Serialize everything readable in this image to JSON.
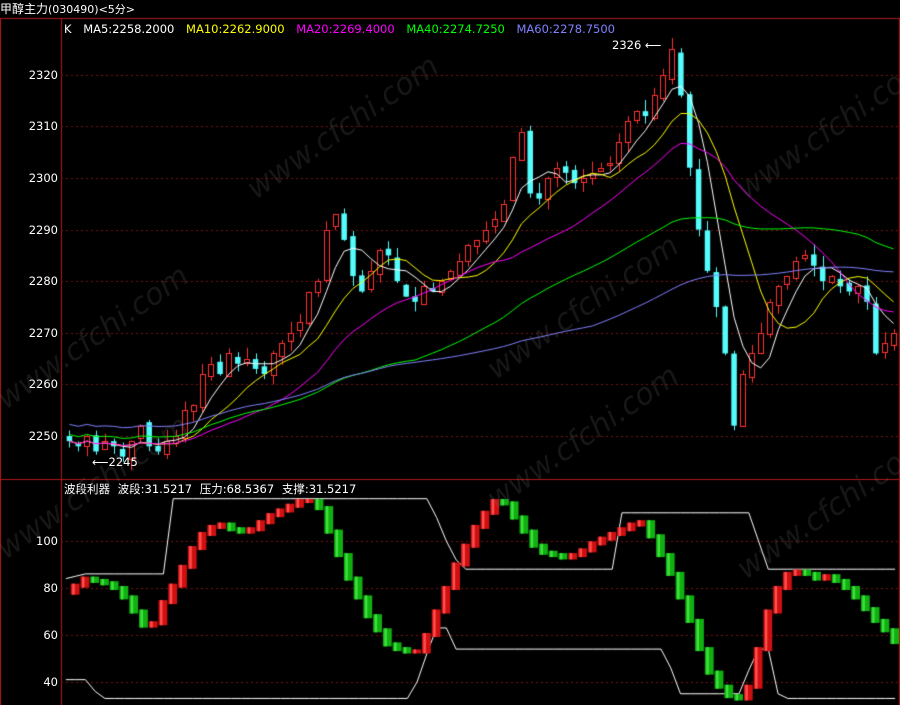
{
  "header": {
    "symbol_name": "甲醇主力",
    "symbol_code": "(030490)",
    "period": "<5分>"
  },
  "legend_main": {
    "k_label": "K",
    "ma5": "MA5:2258.2000",
    "ma10": "MA10:2262.9000",
    "ma20": "MA20:2269.4000",
    "ma40": "MA40:2274.7250",
    "ma60": "MA60:2278.7500"
  },
  "legend_indicator": {
    "name": "波段利器",
    "wave": "波段:31.5217",
    "pressure": "压力:68.5367",
    "support": "支撑:31.5217"
  },
  "annotations": {
    "high": "2326",
    "low": "2245"
  },
  "watermark": "www.cfchi.com",
  "colors": {
    "up": "#ff3232",
    "down": "#54fcfc",
    "ma5": "#ffffff",
    "ma10": "#ffff00",
    "ma20": "#ff00ff",
    "ma40": "#00ff00",
    "ma60": "#8080ff",
    "grid": "#7a1010",
    "frame": "#b01818"
  },
  "chart_data": [
    {
      "type": "candlestick",
      "y_ticks": [
        "2320",
        "2310",
        "2300",
        "2290",
        "2280",
        "2270",
        "2260",
        "2250"
      ],
      "ylim": [
        2244,
        2328
      ],
      "close": [
        2249,
        2248,
        2250,
        2247,
        2249,
        2248,
        2246,
        2249,
        2252,
        2248,
        2247,
        2249,
        2250,
        2255,
        2256,
        2262,
        2264,
        2262,
        2266,
        2264,
        2265,
        2263,
        2262,
        2266,
        2268,
        2270,
        2272,
        2278,
        2280,
        2290,
        2293,
        2288,
        2281,
        2278,
        2282,
        2286,
        2285,
        2280,
        2277,
        2276,
        2279,
        2278,
        2280,
        2282,
        2284,
        2287,
        2288,
        2290,
        2292,
        2295,
        2304,
        2309,
        2297,
        2296,
        2300,
        2302,
        2301,
        2299,
        2300,
        2301,
        2302,
        2303,
        2307,
        2311,
        2313,
        2312,
        2316,
        2320,
        2325,
        2316,
        2302,
        2290,
        2282,
        2275,
        2266,
        2252,
        2262,
        2266,
        2270,
        2276,
        2279,
        2281,
        2284,
        2285,
        2283,
        2280,
        2281,
        2279,
        2278,
        2279,
        2276,
        2266,
        2268,
        2270
      ]
    },
    {
      "type": "line",
      "title": "波段利器",
      "y_ticks": [
        "100",
        "80",
        "60",
        "40"
      ],
      "ylim": [
        30,
        123
      ],
      "series": [
        {
          "name": "波段",
          "values": [
            78,
            81,
            84,
            83,
            82,
            80,
            76,
            70,
            64,
            65,
            74,
            81,
            89,
            97,
            103,
            106,
            107,
            105,
            104,
            105,
            108,
            111,
            113,
            115,
            117,
            117,
            114,
            104,
            94,
            84,
            76,
            68,
            62,
            56,
            54,
            53,
            53,
            60,
            70,
            80,
            90,
            98,
            106,
            112,
            117,
            116,
            110,
            104,
            98,
            95,
            94,
            93,
            94,
            96,
            99,
            101,
            103,
            105,
            107,
            108,
            102,
            94,
            86,
            76,
            66,
            54,
            44,
            38,
            34,
            33,
            38,
            54,
            70,
            80,
            86,
            87,
            86,
            84,
            85,
            83,
            80,
            76,
            71,
            66,
            62,
            57
          ],
          "color_by_direction": true
        },
        {
          "name": "压力",
          "values": [
            84,
            85,
            86,
            86,
            86,
            86,
            86,
            86,
            86,
            86,
            86,
            118,
            118,
            118,
            118,
            118,
            118,
            118,
            118,
            118,
            118,
            118,
            118,
            118,
            118,
            118,
            118,
            118,
            118,
            118,
            118,
            118,
            118,
            118,
            118,
            118,
            118,
            118,
            110,
            100,
            92,
            88,
            88,
            88,
            88,
            88,
            88,
            88,
            88,
            88,
            88,
            88,
            88,
            88,
            88,
            88,
            88,
            112,
            112,
            112,
            112,
            112,
            112,
            112,
            112,
            112,
            112,
            112,
            112,
            112,
            112,
            100,
            88,
            88,
            88,
            88,
            88,
            88,
            88,
            88,
            88,
            88,
            88,
            88,
            88,
            88
          ]
        },
        {
          "name": "支撑",
          "values": [
            41,
            41,
            41,
            36,
            33,
            33,
            33,
            33,
            33,
            33,
            33,
            33,
            33,
            33,
            33,
            33,
            33,
            33,
            33,
            33,
            33,
            33,
            33,
            33,
            33,
            33,
            33,
            33,
            33,
            33,
            33,
            33,
            33,
            33,
            33,
            33,
            40,
            52,
            63,
            63,
            54,
            54,
            54,
            54,
            54,
            54,
            54,
            54,
            54,
            54,
            54,
            54,
            54,
            54,
            54,
            54,
            54,
            54,
            54,
            54,
            54,
            54,
            46,
            35,
            35,
            35,
            35,
            35,
            35,
            35,
            45,
            54,
            54,
            35,
            33,
            33,
            33,
            33,
            33,
            33,
            33,
            33,
            33,
            33,
            33,
            33
          ]
        }
      ]
    }
  ]
}
